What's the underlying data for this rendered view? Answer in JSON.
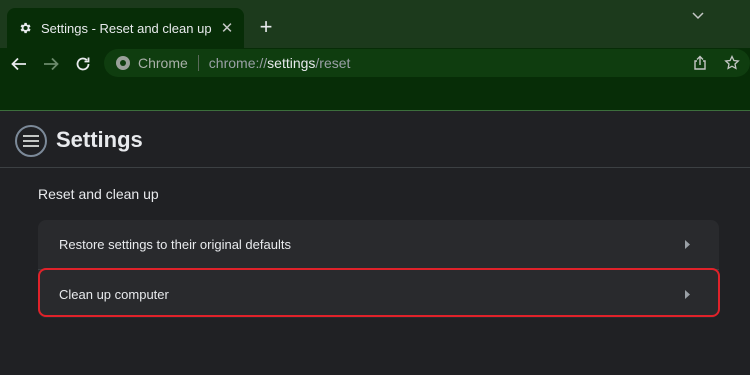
{
  "browser": {
    "tab": {
      "title": "Settings - Reset and clean up",
      "icon": "gear-icon",
      "close": "✕"
    },
    "new_tab_label": "+",
    "omnibox": {
      "site_label": "Chrome",
      "url_scheme": "chrome://",
      "url_host": "settings",
      "url_path": "/reset"
    }
  },
  "settings": {
    "title": "Settings",
    "section_title": "Reset and clean up",
    "items": [
      {
        "label": "Restore settings to their original defaults"
      },
      {
        "label": "Clean up computer"
      }
    ]
  },
  "colors": {
    "frame": "#1c3a1c",
    "toolbar": "#072d07",
    "page_bg": "#202124",
    "card_bg": "#292a2d",
    "highlight": "#e0222a"
  }
}
